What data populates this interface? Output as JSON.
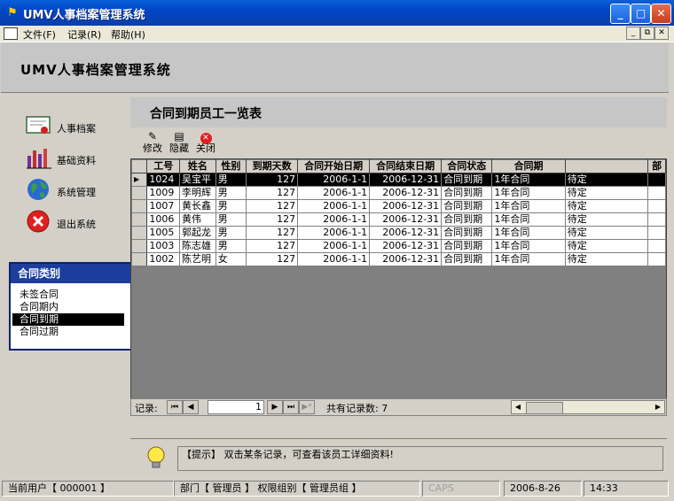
{
  "window": {
    "title": "UMV人事档案管理系统"
  },
  "menu": [
    {
      "label": "文件(F)"
    },
    {
      "label": "记录(R)"
    },
    {
      "label": "帮助(H)"
    }
  ],
  "header": {
    "title": "UMV人事档案管理系统"
  },
  "nav": [
    {
      "label": "人事档案",
      "icon": "certificate-icon"
    },
    {
      "label": "基础资料",
      "icon": "bar-chart-icon"
    },
    {
      "label": "系统管理",
      "icon": "globe-icon"
    },
    {
      "label": "退出系统",
      "icon": "exit-icon"
    }
  ],
  "contract_types": {
    "title": "合同类别",
    "items": [
      "未签合同",
      "合同期内",
      "合同到期",
      "合同过期"
    ],
    "selected_index": 2
  },
  "panel": {
    "title": "合同到期员工一览表"
  },
  "toolbar": {
    "edit": "修改",
    "hide": "隐藏",
    "close": "关闭"
  },
  "table": {
    "columns": [
      "工号",
      "姓名",
      "性别",
      "到期天数",
      "合同开始日期",
      "合同结束日期",
      "合同状态",
      "合同期",
      "",
      "部"
    ],
    "rows": [
      [
        "1024",
        "吴宝平",
        "男",
        "127",
        "2006-1-1",
        "2006-12-31",
        "合同到期",
        "1年合同",
        "待定"
      ],
      [
        "1009",
        "李明辉",
        "男",
        "127",
        "2006-1-1",
        "2006-12-31",
        "合同到期",
        "1年合同",
        "待定"
      ],
      [
        "1007",
        "黄长鑫",
        "男",
        "127",
        "2006-1-1",
        "2006-12-31",
        "合同到期",
        "1年合同",
        "待定"
      ],
      [
        "1006",
        "黄伟",
        "男",
        "127",
        "2006-1-1",
        "2006-12-31",
        "合同到期",
        "1年合同",
        "待定"
      ],
      [
        "1005",
        "郭起龙",
        "男",
        "127",
        "2006-1-1",
        "2006-12-31",
        "合同到期",
        "1年合同",
        "待定"
      ],
      [
        "1003",
        "陈志雄",
        "男",
        "127",
        "2006-1-1",
        "2006-12-31",
        "合同到期",
        "1年合同",
        "待定"
      ],
      [
        "1002",
        "陈艺明",
        "女",
        "127",
        "2006-1-1",
        "2006-12-31",
        "合同到期",
        "1年合同",
        "待定"
      ]
    ],
    "current_row": 0
  },
  "recordnav": {
    "label": "记录:",
    "current": "1",
    "total": "共有记录数: 7"
  },
  "hint": {
    "text": "【提示】 双击某条记录，可查看该员工详细资料!"
  },
  "status": {
    "user": "当前用户【 000001 】",
    "dept": "部门【 管理员 】 权限组别【 管理员组 】",
    "caps": "CAPS",
    "date": "2006-8-26",
    "time": "14:33"
  }
}
